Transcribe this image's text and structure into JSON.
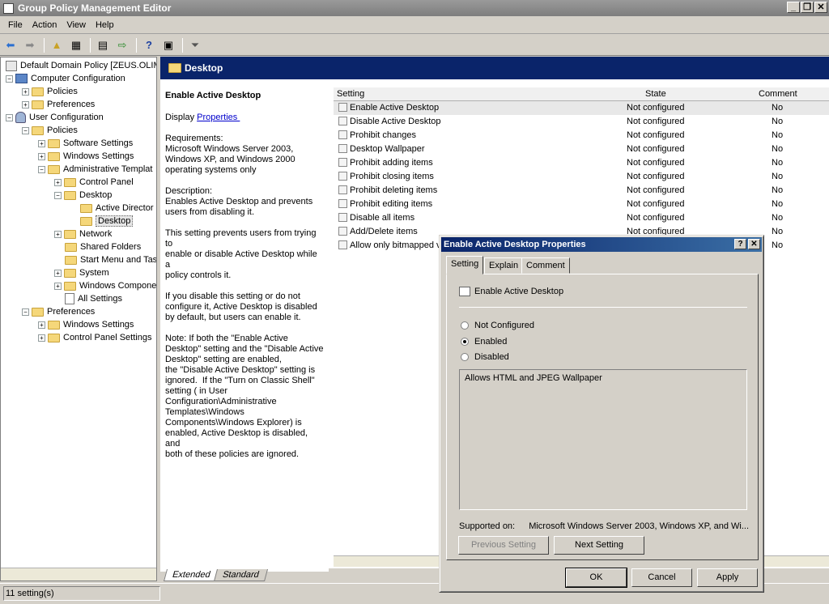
{
  "window": {
    "title": "Group Policy Management Editor"
  },
  "menu": [
    "File",
    "Action",
    "View",
    "Help"
  ],
  "tree": {
    "root": "Default Domain Policy [ZEUS.OLIMP",
    "computer_config": "Computer Configuration",
    "cc_policies": "Policies",
    "cc_preferences": "Preferences",
    "user_config": "User Configuration",
    "uc_policies": "Policies",
    "software_settings": "Software Settings",
    "windows_settings": "Windows Settings",
    "admin_templates": "Administrative Templat",
    "control_panel": "Control Panel",
    "desktop": "Desktop",
    "active_directory": "Active Director",
    "desktop_sub": "Desktop",
    "network": "Network",
    "shared_folders": "Shared Folders",
    "start_menu": "Start Menu and Tas",
    "system": "System",
    "windows_components": "Windows Compone",
    "all_settings": "All Settings",
    "uc_preferences": "Preferences",
    "pref_windows_settings": "Windows Settings",
    "pref_cp_settings": "Control Panel Settings"
  },
  "header": {
    "title": "Desktop"
  },
  "description": {
    "title": "Enable Active Desktop",
    "display_label": "Display",
    "properties_link": "Properties ",
    "body": "Requirements:\nMicrosoft Windows Server 2003,\nWindows XP, and Windows 2000\noperating systems only\n\nDescription:\nEnables Active Desktop and prevents\nusers from disabling it.\n\nThis setting prevents users from trying to\nenable or disable Active Desktop while a\npolicy controls it.\n\nIf you disable this setting or do not\nconfigure it, Active Desktop is disabled\nby default, but users can enable it.\n\nNote: If both the \"Enable Active\nDesktop\" setting and the \"Disable Active\nDesktop\" setting are enabled,\nthe \"Disable Active Desktop\" setting is\nignored.  If the \"Turn on Classic Shell\"\nsetting ( in User\nConfiguration\\Administrative\nTemplates\\Windows\nComponents\\Windows Explorer) is\nenabled, Active Desktop is disabled, and\nboth of these policies are ignored."
  },
  "list": {
    "columns": [
      "Setting",
      "State",
      "Comment"
    ],
    "rows": [
      {
        "setting": "Enable Active Desktop",
        "state": "Not configured",
        "comment": "No"
      },
      {
        "setting": "Disable Active Desktop",
        "state": "Not configured",
        "comment": "No"
      },
      {
        "setting": "Prohibit changes",
        "state": "Not configured",
        "comment": "No"
      },
      {
        "setting": "Desktop Wallpaper",
        "state": "Not configured",
        "comment": "No"
      },
      {
        "setting": "Prohibit adding items",
        "state": "Not configured",
        "comment": "No"
      },
      {
        "setting": "Prohibit closing items",
        "state": "Not configured",
        "comment": "No"
      },
      {
        "setting": "Prohibit deleting items",
        "state": "Not configured",
        "comment": "No"
      },
      {
        "setting": "Prohibit editing items",
        "state": "Not configured",
        "comment": "No"
      },
      {
        "setting": "Disable all items",
        "state": "Not configured",
        "comment": "No"
      },
      {
        "setting": "Add/Delete items",
        "state": "Not configured",
        "comment": "No"
      },
      {
        "setting": "Allow only bitmapped v",
        "state": "",
        "comment": "No"
      }
    ]
  },
  "bottom_tabs": [
    "Extended",
    "Standard"
  ],
  "status": "11 setting(s)",
  "dialog": {
    "title": "Enable Active Desktop Properties",
    "tabs": [
      "Setting",
      "Explain",
      "Comment"
    ],
    "setting_name": "Enable Active Desktop",
    "options": [
      "Not Configured",
      "Enabled",
      "Disabled"
    ],
    "selected": "Enabled",
    "comment": "Allows HTML and JPEG Wallpaper",
    "supported_label": "Supported on:",
    "supported_value": "Microsoft Windows Server 2003, Windows XP, and Wi...",
    "prev_button": "Previous Setting",
    "next_button": "Next Setting",
    "ok": "OK",
    "cancel": "Cancel",
    "apply": "Apply"
  }
}
